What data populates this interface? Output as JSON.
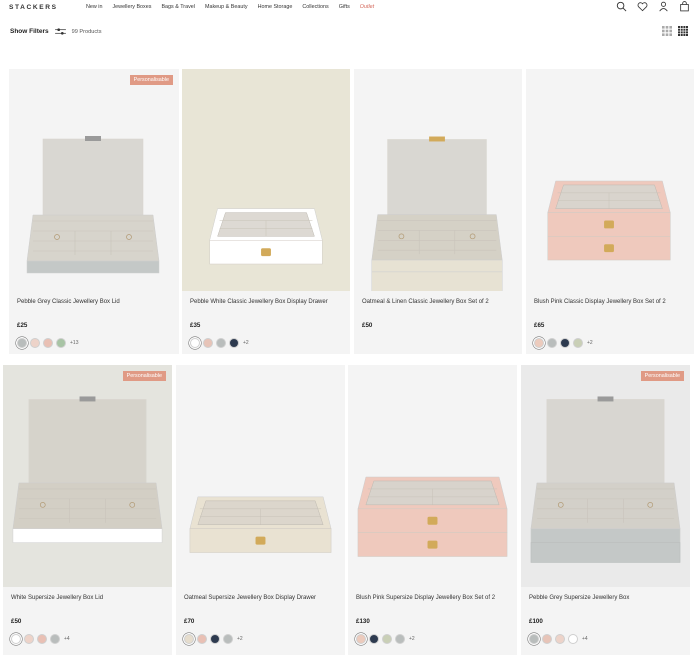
{
  "brand": "STACKERS",
  "nav": [
    "New in",
    "Jewellery Boxes",
    "Bags & Travel",
    "Makeup & Beauty",
    "Home Storage",
    "Collections",
    "Gifts"
  ],
  "nav_outlet": "Outlet",
  "icons": [
    "search-icon",
    "heart-icon",
    "user-icon",
    "bag-icon"
  ],
  "filter": {
    "label": "Show Filters",
    "count": "99 Products"
  },
  "colors": {
    "badge": "#e09a85",
    "outlet": "#d4695c",
    "card_bg": "#f4f4f4"
  },
  "products": [
    {
      "name": "Pebble Grey Classic Jewellery Box Lid",
      "price": "£25",
      "badge": "Personalisable",
      "swatches": [
        "#b9bdbc",
        "#edd3c9",
        "#e9c0b4",
        "#a8c4a5"
      ],
      "more": "+13",
      "box": "grey-lid"
    },
    {
      "name": "Pebble White Classic Jewellery Box Display Drawer",
      "price": "£35",
      "badge": "",
      "swatches": [
        "#ffffff",
        "#e7c4b8",
        "#b9bdbc",
        "#2d3a4f"
      ],
      "more": "+2",
      "box": "white-drawer"
    },
    {
      "name": "Oatmeal & Linen Classic Jewellery Box Set of 2",
      "price": "£50",
      "badge": "",
      "swatches": [],
      "more": "",
      "box": "oatmeal-set"
    },
    {
      "name": "Blush Pink Classic Display Jewellery Box Set of 2",
      "price": "£65",
      "badge": "",
      "swatches": [
        "#eccbbd",
        "#b9bdbc",
        "#2d3a4f",
        "#c9cfb6"
      ],
      "more": "+2",
      "box": "blush-set"
    },
    {
      "name": "White Supersize Jewellery Box Lid",
      "price": "£50",
      "badge": "Personalisable",
      "swatches": [
        "#ffffff",
        "#edd3c9",
        "#e9c0b4",
        "#b9bdbc"
      ],
      "more": "+4",
      "box": "white-lid"
    },
    {
      "name": "Oatmeal Supersize Jewellery Box Display Drawer",
      "price": "£70",
      "badge": "",
      "swatches": [
        "#e6ddcd",
        "#e9c0b4",
        "#2d3a4f",
        "#b9bdbc"
      ],
      "more": "+2",
      "box": "oatmeal-drawer"
    },
    {
      "name": "Blush Pink Supersize Display Jewellery Box Set of 2",
      "price": "£130",
      "badge": "",
      "swatches": [
        "#eccbbd",
        "#2d3a4f",
        "#c9cfb6",
        "#b9bdbc"
      ],
      "more": "+2",
      "box": "blush-super"
    },
    {
      "name": "Pebble Grey Supersize Jewellery Box",
      "price": "£100",
      "badge": "Personalisable",
      "swatches": [
        "#b9bdbc",
        "#e7c4b8",
        "#edd3c9",
        "#ffffff"
      ],
      "more": "+4",
      "box": "grey-super"
    }
  ]
}
